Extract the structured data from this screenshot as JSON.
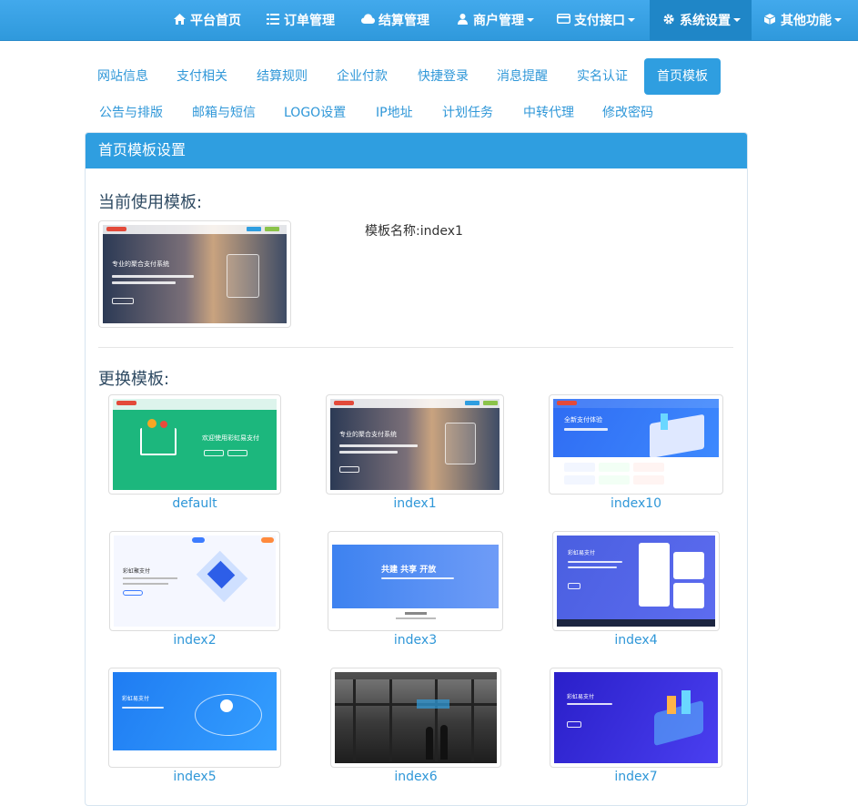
{
  "navbar": {
    "items": [
      {
        "label": "平台首页",
        "icon": "home-icon",
        "dropdown": false
      },
      {
        "label": "订单管理",
        "icon": "list-icon",
        "dropdown": false
      },
      {
        "label": "结算管理",
        "icon": "cloud-icon",
        "dropdown": false
      },
      {
        "label": "商户管理",
        "icon": "user-icon",
        "dropdown": true
      },
      {
        "label": "支付接口",
        "icon": "card-icon",
        "dropdown": true
      },
      {
        "label": "系统设置",
        "icon": "gear-icon",
        "dropdown": true,
        "active": true
      },
      {
        "label": "其他功能",
        "icon": "cube-icon",
        "dropdown": true
      }
    ]
  },
  "tabs": {
    "row1": [
      "网站信息",
      "支付相关",
      "结算规则",
      "企业付款",
      "快捷登录",
      "消息提醒",
      "实名认证",
      "首页模板"
    ],
    "row2": [
      "公告与排版",
      "邮箱与短信",
      "LOGO设置",
      "IP地址",
      "计划任务",
      "中转代理",
      "修改密码"
    ],
    "active": "首页模板"
  },
  "panel": {
    "heading": "首页模板设置",
    "current_title": "当前使用模板:",
    "template_name_label": "模板名称:",
    "template_name_value": "index1",
    "change_title": "更换模板:"
  },
  "templates": [
    {
      "name": "default"
    },
    {
      "name": "index1"
    },
    {
      "name": "index10"
    },
    {
      "name": "index2"
    },
    {
      "name": "index3"
    },
    {
      "name": "index4"
    },
    {
      "name": "index5"
    },
    {
      "name": "index6"
    },
    {
      "name": "index7"
    }
  ],
  "thumb_text": {
    "index1_slogan": "专业的聚合支付系统",
    "default_slogan": "欢迎使用彩虹易支付",
    "index10_slogan": "全新支付体验",
    "index2_slogan": "彩虹聚支付",
    "index3_slogan": "共建  共享  开放",
    "index4_slogan": "彩虹易支付",
    "index5_slogan": "彩虹易支付",
    "index7_slogan": "彩虹易支付"
  },
  "colors": {
    "primary": "#2f9ee0",
    "link": "#2f97d8",
    "navbar": "#3aa3e6"
  }
}
